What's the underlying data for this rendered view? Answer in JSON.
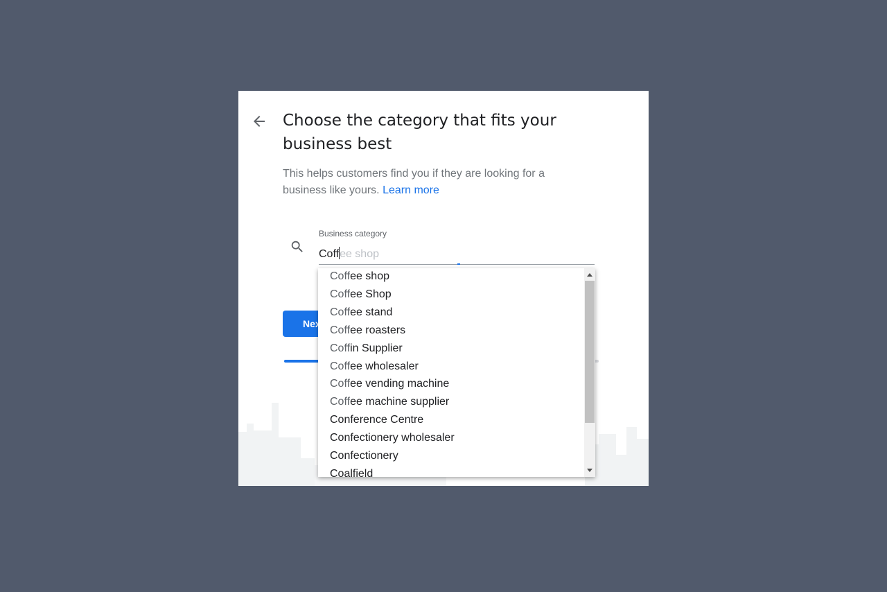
{
  "header": {
    "title": "Choose the category that fits your business best",
    "subtitle": "This helps customers find you if they are looking for a business like yours.",
    "learn_more": "Learn more"
  },
  "search": {
    "label": "Business category",
    "typed_value": "Coff",
    "autocomplete_hint": "ee shop"
  },
  "next_button": {
    "label": "Next"
  },
  "suggestions": [
    {
      "match": "Coff",
      "rest": "ee shop"
    },
    {
      "match": "Coff",
      "rest": "ee Shop"
    },
    {
      "match": "Coff",
      "rest": "ee stand"
    },
    {
      "match": "Coff",
      "rest": "ee roasters"
    },
    {
      "match": "Coff",
      "rest": "in Supplier"
    },
    {
      "match": "Coff",
      "rest": "ee wholesaler"
    },
    {
      "match": "Coff",
      "rest": "ee vending machine"
    },
    {
      "match": "Coff",
      "rest": "ee machine supplier"
    },
    {
      "match": "",
      "rest": "Conference Centre"
    },
    {
      "match": "",
      "rest": "Confectionery wholesaler"
    },
    {
      "match": "",
      "rest": "Confectionery"
    },
    {
      "match": "",
      "rest": "Coalfield"
    }
  ],
  "colors": {
    "accent": "#1a73e8",
    "background": "#515a6c",
    "card": "#ffffff",
    "text": "#202124",
    "muted": "#70757a"
  }
}
